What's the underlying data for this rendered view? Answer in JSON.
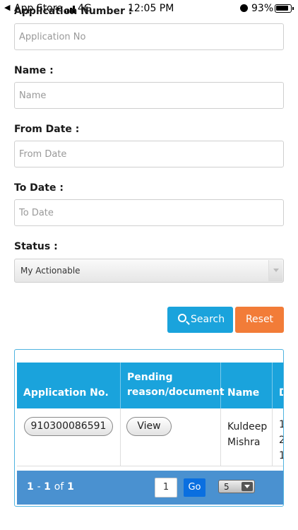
{
  "status_bar": {
    "back_label": "App Store",
    "network": "4G",
    "time": "12:05 PM",
    "battery": "93%"
  },
  "form": {
    "application_number": {
      "label": "Application Number :",
      "placeholder": "Application No"
    },
    "name": {
      "label": "Name :",
      "placeholder": "Name"
    },
    "from_date": {
      "label": "From Date :",
      "placeholder": "From Date"
    },
    "to_date": {
      "label": "To Date :",
      "placeholder": "To Date"
    },
    "status": {
      "label": "Status :",
      "selected": "My Actionable"
    },
    "search_label": "Search",
    "reset_label": "Reset"
  },
  "table": {
    "columns": [
      "Application No.",
      "Pending reason/document",
      "Name",
      "D"
    ],
    "rows": [
      {
        "application_no": "910300086591",
        "action": "View",
        "name": "Kuldeep Mishra",
        "date_fragments": [
          "1",
          "2",
          "1"
        ]
      }
    ],
    "pagination": {
      "range_start": "1",
      "range_end": "1",
      "of_word": "of",
      "total": "1",
      "page": "1",
      "go_label": "Go",
      "page_size": "5"
    }
  },
  "colors": {
    "primary": "#1aa3dc",
    "reset": "#f27c38",
    "footer": "#4a91d0",
    "go": "#0a6fe0"
  }
}
